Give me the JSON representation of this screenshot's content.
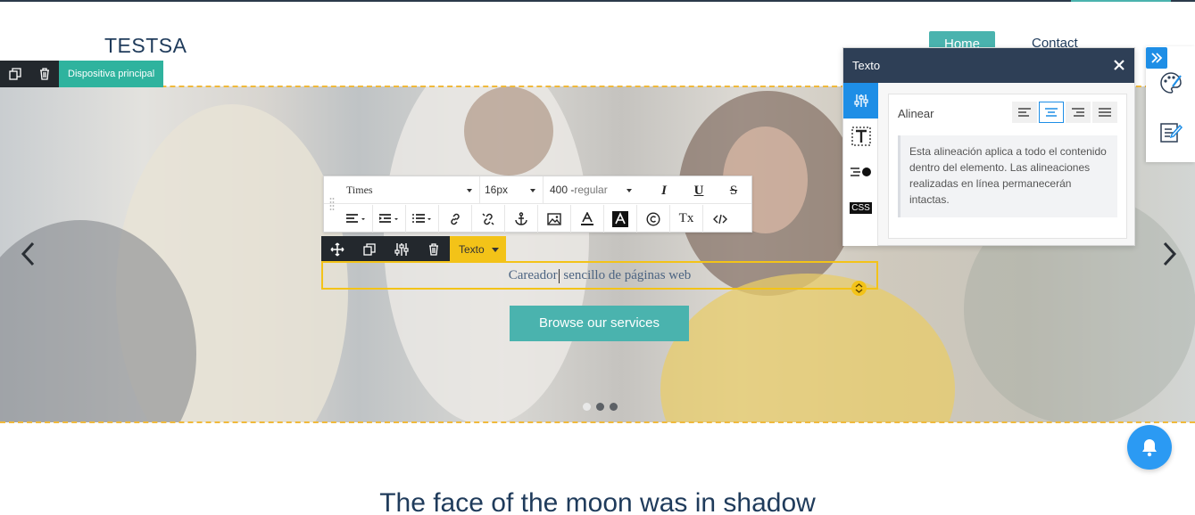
{
  "site": {
    "logo": "TESTSA",
    "nav": {
      "home": "Home",
      "contact": "Contact"
    }
  },
  "section_toolbar": {
    "label": "Dispositiva principal"
  },
  "hero": {
    "carousel_dots": 3,
    "active_dot": 1,
    "cta_label": "Browse our services"
  },
  "text_element": {
    "before_cursor": "Careador",
    "after_cursor": " sencillo de páginas web"
  },
  "rte": {
    "font": "Times",
    "size": "16px",
    "weight_num": "400 -",
    "weight_name": "regular",
    "italic": "I",
    "underline": "U",
    "strike": "S",
    "clear_format": "Tx"
  },
  "element_toolbar": {
    "label": "Texto"
  },
  "panel": {
    "title": "Texto",
    "align_label": "Alinear",
    "help_text": "Esta alineación aplica a todo el contenido dentro del elemento. Las alineaciones realizadas en línea permanecerán intactas.",
    "css_tab": "CSS",
    "active_alignment": "center"
  },
  "section_below": {
    "headline": "The face of the moon was in shadow"
  },
  "colors": {
    "teal": "#4ab3ae",
    "navy": "#2e3f56",
    "selection_yellow": "#f3c318",
    "blue": "#1e8ee6"
  }
}
